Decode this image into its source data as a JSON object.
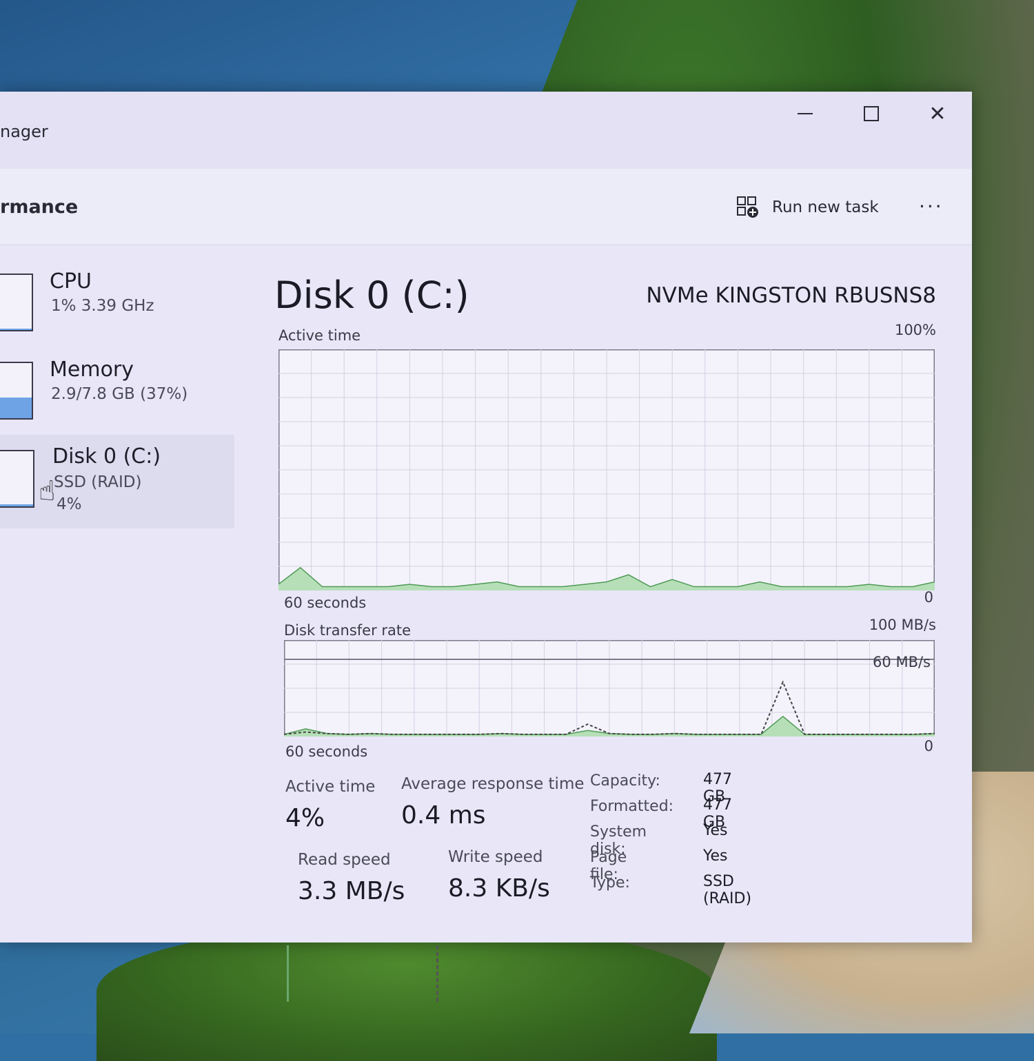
{
  "window": {
    "title_partial": "nager"
  },
  "header": {
    "page_title_partial": "rmance",
    "run_task_label": "Run new task",
    "more_label": "..."
  },
  "sidebar": {
    "items": [
      {
        "title": "CPU",
        "subtitle": "1%  3.39 GHz",
        "fill_percent": 3
      },
      {
        "title": "Memory",
        "subtitle": "2.9/7.8 GB (37%)",
        "fill_percent": 37
      },
      {
        "title": "Disk 0 (C:)",
        "subtitle": "SSD (RAID)",
        "subtitle2": "4%",
        "fill_percent": 4,
        "selected": true
      }
    ]
  },
  "main": {
    "title": "Disk 0 (C:)",
    "model": "NVMe KINGSTON RBUSNS8",
    "active_chart": {
      "label": "Active time",
      "max_label": "100%",
      "time_label": "60 seconds",
      "min_label": "0"
    },
    "transfer_chart": {
      "label": "Disk transfer rate",
      "max_label": "100 MB/s",
      "inner_label": "60 MB/s",
      "time_label": "60 seconds",
      "min_label": "0"
    },
    "stats": {
      "active_time_label": "Active time",
      "active_time_value": "4%",
      "avg_response_label": "Average response time",
      "avg_response_value": "0.4 ms",
      "read_label": "Read speed",
      "read_value": "3.3 MB/s",
      "write_label": "Write speed",
      "write_value": "8.3 KB/s"
    },
    "properties": [
      {
        "label": "Capacity:",
        "value": "477 GB"
      },
      {
        "label": "Formatted:",
        "value": "477 GB"
      },
      {
        "label": "System disk:",
        "value": "Yes"
      },
      {
        "label": "Page file:",
        "value": "Yes"
      },
      {
        "label": "Type:",
        "value": "SSD (RAID)"
      }
    ]
  },
  "chart_data": [
    {
      "type": "area",
      "title": "Active time",
      "x": [
        60,
        58,
        56,
        54,
        52,
        50,
        48,
        46,
        44,
        42,
        40,
        38,
        36,
        34,
        32,
        30,
        28,
        26,
        24,
        22,
        20,
        18,
        16,
        14,
        12,
        10,
        8,
        6,
        4,
        2,
        0
      ],
      "series": [
        {
          "values": [
            2,
            9,
            1,
            1,
            1,
            1,
            2,
            1,
            1,
            2,
            3,
            1,
            1,
            1,
            2,
            3,
            6,
            1,
            4,
            1,
            1,
            1,
            3,
            1,
            1,
            1,
            1,
            2,
            1,
            1,
            3
          ]
        }
      ],
      "xlabel": "60 seconds",
      "ylim": [
        0,
        100
      ],
      "ytick_labels": [
        "100%",
        "0"
      ],
      "colors": {
        "fill": "#b6dfb8",
        "line": "#4f9a55"
      }
    },
    {
      "type": "area",
      "title": "Disk transfer rate",
      "x": [
        60,
        58,
        56,
        54,
        52,
        50,
        48,
        46,
        44,
        42,
        40,
        38,
        36,
        34,
        32,
        30,
        28,
        26,
        24,
        22,
        20,
        18,
        16,
        14,
        12,
        10,
        8,
        6,
        4,
        2,
        0
      ],
      "series": [
        {
          "values": [
            0.5,
            4,
            1,
            0.5,
            1,
            0.5,
            0.5,
            0.5,
            0.5,
            0.5,
            1,
            0.5,
            0.5,
            0.5,
            3,
            1,
            0.5,
            0.5,
            1,
            0.5,
            0.5,
            0.5,
            0.5,
            12,
            0.5,
            0.5,
            0.5,
            0.5,
            0.5,
            0.5,
            1
          ]
        },
        {
          "values": [
            0.5,
            2,
            1,
            0.5,
            1,
            0.5,
            0.5,
            0.5,
            0.5,
            0.5,
            1,
            0.5,
            0.5,
            0.5,
            7,
            1,
            0.5,
            0.5,
            1,
            0.5,
            0.5,
            0.5,
            0.5,
            34,
            0.5,
            0.5,
            0.5,
            0.5,
            0.5,
            0.5,
            1
          ],
          "style": "dashed"
        }
      ],
      "xlabel": "60 seconds",
      "ylim": [
        0,
        60
      ],
      "ytick_labels": [
        "100 MB/s",
        "60 MB/s",
        "0"
      ],
      "colors": {
        "fill": "#b6dfb8",
        "line": "#4f9a55",
        "dashed": "#444444"
      }
    }
  ]
}
